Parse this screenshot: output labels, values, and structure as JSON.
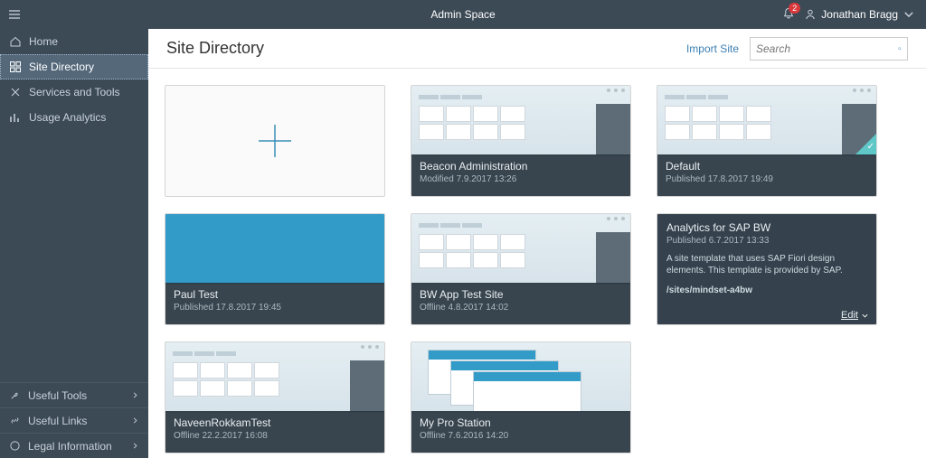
{
  "topbar": {
    "title": "Admin Space",
    "notif_count": "2",
    "user": "Jonathan Bragg"
  },
  "sidebar": {
    "nav": [
      {
        "label": "Home"
      },
      {
        "label": "Site Directory"
      },
      {
        "label": "Services and Tools"
      },
      {
        "label": "Usage Analytics"
      }
    ],
    "footer": [
      {
        "label": "Useful Tools"
      },
      {
        "label": "Useful Links"
      },
      {
        "label": "Legal Information"
      }
    ]
  },
  "page": {
    "title": "Site Directory",
    "import": "Import Site",
    "search_placeholder": "Search"
  },
  "cards": [
    {
      "title": "Beacon Administration",
      "sub": "Modified 7.9.2017 13:26"
    },
    {
      "title": "Default",
      "sub": "Published 17.8.2017 19:49"
    },
    {
      "title": "Paul Test",
      "sub": "Published 17.8.2017 19:45"
    },
    {
      "title": "BW App Test Site",
      "sub": "Offline 4.8.2017 14:02"
    },
    {
      "title": "NaveenRokkamTest",
      "sub": "Offline 22.2.2017 16:08"
    },
    {
      "title": "My Pro Station",
      "sub": "Offline 7.6.2016 14:20"
    }
  ],
  "detail": {
    "title": "Analytics for SAP BW",
    "sub": "Published 6.7.2017 13:33",
    "desc": "A site template that uses SAP Fiori design elements. This template is provided by SAP.",
    "path": "/sites/mindset-a4bw",
    "edit": "Edit"
  }
}
